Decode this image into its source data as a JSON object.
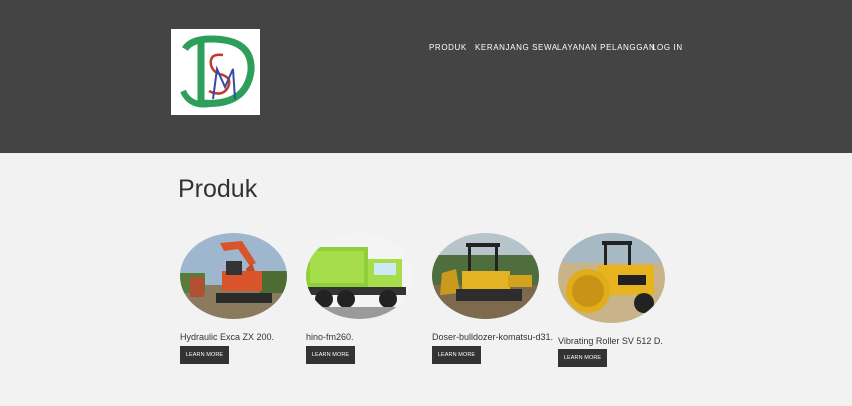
{
  "header": {
    "logo_alt": "DSM",
    "nav": [
      {
        "label": "PRODUK"
      },
      {
        "label": "KERANJANG SEWA"
      },
      {
        "label": "LAYANAN PELANGGAN"
      },
      {
        "label": "LOG IN"
      }
    ]
  },
  "main": {
    "title": "Produk",
    "products": [
      {
        "name": "Hydraulic Exca ZX 200.",
        "button": "LEARN MORE",
        "image": "excavator-image"
      },
      {
        "name": "hino-fm260.",
        "button": "LEARN MORE",
        "image": "dump-truck-image"
      },
      {
        "name": "Doser-bulldozer-komatsu-d31.",
        "button": "LEARN MORE",
        "image": "bulldozer-image"
      },
      {
        "name": "Vibrating Roller SV 512 D.",
        "button": "LEARN MORE",
        "image": "roller-image"
      }
    ]
  },
  "colors": {
    "header_bg": "#444444",
    "page_bg": "#f2f2f2",
    "button_bg": "#333333",
    "logo_green": "#2e9e5b",
    "logo_red": "#c0392b"
  }
}
